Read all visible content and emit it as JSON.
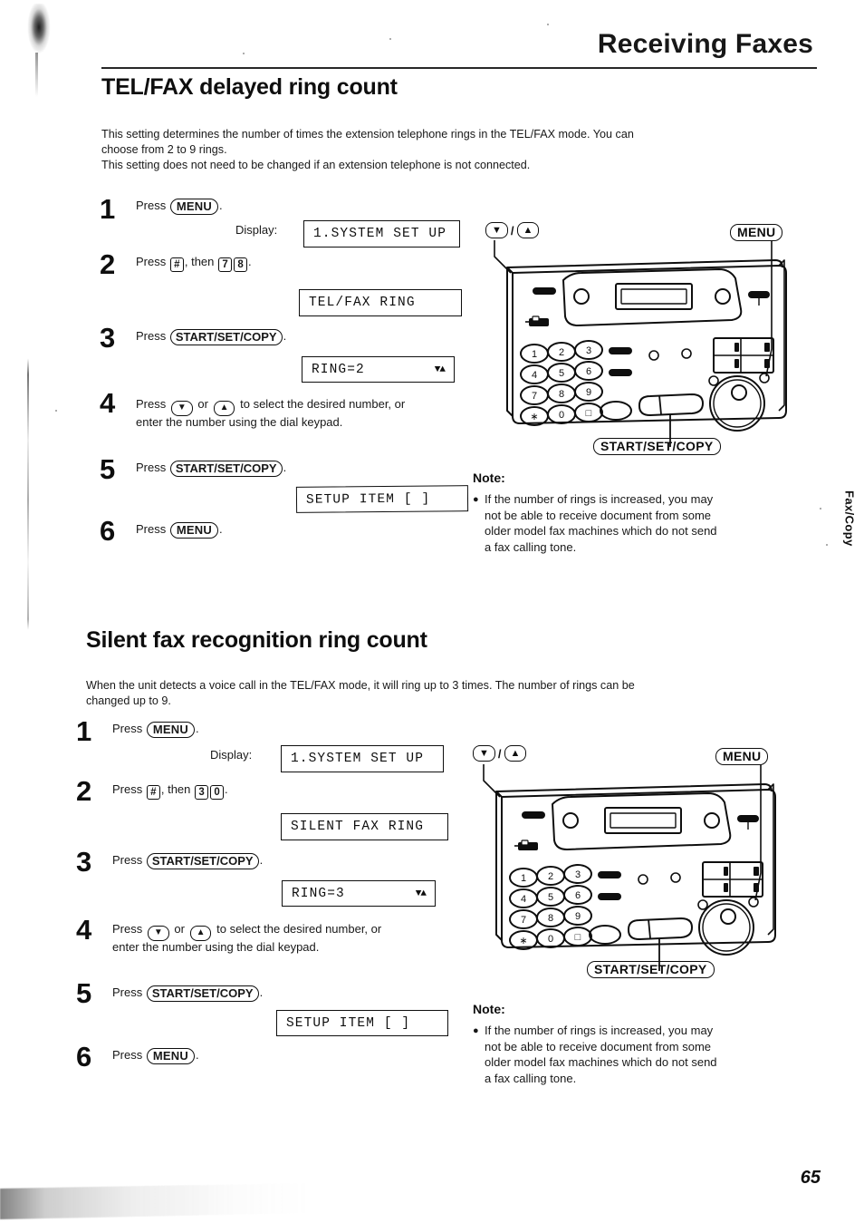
{
  "page": {
    "header_title": "Receiving Faxes",
    "page_number": "65",
    "side_tab": "Fax/Copy"
  },
  "sections": [
    {
      "title": "TEL/FAX delayed ring count",
      "intro": "This setting determines the number of times the extension telephone rings in the TEL/FAX mode. You can choose from 2 to 9 rings.\nThis setting does not need to be changed if an extension telephone is not connected.",
      "intro_line1": "This setting determines the number of times the extension telephone rings in the TEL/FAX mode. You can",
      "intro_line2": "choose from 2 to 9 rings.",
      "intro_line3": "This setting does not need to be changed if an extension telephone is not connected.",
      "steps": [
        {
          "num": "1",
          "press_label": "Press",
          "key": "MENU",
          "trailing": "."
        },
        {
          "num": "2",
          "press_label": "Press",
          "key1": "#",
          "then_label": ", then",
          "key2": "7",
          "key3": "8",
          "trailing": "."
        },
        {
          "num": "3",
          "press_label": "Press",
          "key": "START/SET/COPY",
          "trailing": "."
        },
        {
          "num": "4",
          "line1_a": "Press",
          "arrow_down": "▼",
          "or_label": "or",
          "arrow_up": "▲",
          "line1_b": "to select the desired number, or",
          "line2": "enter the number using the dial keypad."
        },
        {
          "num": "5",
          "press_label": "Press",
          "key": "START/SET/COPY",
          "trailing": "."
        },
        {
          "num": "6",
          "press_label": "Press",
          "key": "MENU",
          "trailing": "."
        }
      ],
      "display_label": "Display:",
      "lcds": [
        {
          "text": "1.SYSTEM SET UP",
          "arrows": ""
        },
        {
          "text": "TEL/FAX RING",
          "arrows": ""
        },
        {
          "text": "RING=2",
          "arrows": "▼▲"
        },
        {
          "text": "SETUP ITEM [   ]",
          "arrows": ""
        }
      ],
      "note": {
        "title": "Note:",
        "bullet": "●",
        "lines": [
          "If the number of rings is increased, you may",
          "not be able to receive document from some",
          "older model fax machines which do not send",
          "a fax calling tone."
        ]
      },
      "diagram": {
        "callout_menu": "MENU",
        "callout_start": "START/SET/COPY",
        "arrow_down": "▼",
        "arrow_sep": "/",
        "arrow_up": "▲",
        "keypad": [
          "1",
          "2",
          "3",
          "4",
          "5",
          "6",
          "7",
          "8",
          "9",
          "∗",
          "0",
          "□"
        ]
      }
    },
    {
      "title": "Silent fax recognition ring count",
      "intro_line1": "When the unit detects a voice call in the TEL/FAX mode, it will ring up to 3 times. The number of rings can be",
      "intro_line2": "changed up to 9.",
      "intro_line3": "",
      "steps": [
        {
          "num": "1",
          "press_label": "Press",
          "key": "MENU",
          "trailing": "."
        },
        {
          "num": "2",
          "press_label": "Press",
          "key1": "#",
          "then_label": ", then",
          "key2": "3",
          "key3": "0",
          "trailing": "."
        },
        {
          "num": "3",
          "press_label": "Press",
          "key": "START/SET/COPY",
          "trailing": "."
        },
        {
          "num": "4",
          "line1_a": "Press",
          "arrow_down": "▼",
          "or_label": "or",
          "arrow_up": "▲",
          "line1_b": "to select the desired number, or",
          "line2": "enter the number using the dial keypad."
        },
        {
          "num": "5",
          "press_label": "Press",
          "key": "START/SET/COPY",
          "trailing": "."
        },
        {
          "num": "6",
          "press_label": "Press",
          "key": "MENU",
          "trailing": "."
        }
      ],
      "display_label": "Display:",
      "lcds": [
        {
          "text": "1.SYSTEM SET UP",
          "arrows": ""
        },
        {
          "text": "SILENT FAX RING",
          "arrows": ""
        },
        {
          "text": "RING=3",
          "arrows": "▼▲"
        },
        {
          "text": "SETUP ITEM [   ]",
          "arrows": ""
        }
      ],
      "note": {
        "title": "Note:",
        "bullet": "●",
        "lines": [
          "If the number of rings is increased, you may",
          "not be able to receive document from some",
          "older model fax machines which do not send",
          "a fax calling tone."
        ]
      },
      "diagram": {
        "callout_menu": "MENU",
        "callout_start": "START/SET/COPY",
        "arrow_down": "▼",
        "arrow_sep": "/",
        "arrow_up": "▲",
        "keypad": [
          "1",
          "2",
          "3",
          "4",
          "5",
          "6",
          "7",
          "8",
          "9",
          "∗",
          "0",
          "□"
        ]
      }
    }
  ]
}
